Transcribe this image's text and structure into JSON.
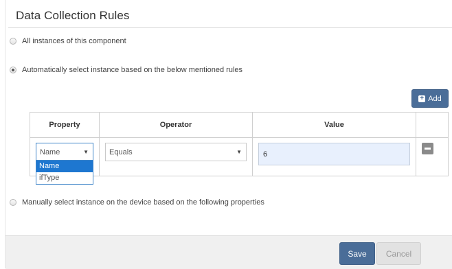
{
  "panel": {
    "title": "Data Collection Rules"
  },
  "options": {
    "all_instances": "All instances of this component",
    "auto_select": "Automatically select instance based on the below mentioned rules",
    "manual_select": "Manually select instance on the device based on the following properties",
    "selected": "auto_select"
  },
  "toolbar": {
    "add_label": "Add"
  },
  "table": {
    "headers": [
      "Property",
      "Operator",
      "Value"
    ],
    "rows": [
      {
        "property": "Name",
        "operator": "Equals",
        "value": "6"
      }
    ]
  },
  "property_dropdown": {
    "options": [
      "Name",
      "ifType"
    ],
    "highlighted": "Name"
  },
  "footer": {
    "save_label": "Save",
    "cancel_label": "Cancel"
  },
  "colors": {
    "primary_button": "#4a6d98",
    "dropdown_highlight": "#1e77d0",
    "value_input_bg": "#e8f0fd"
  }
}
